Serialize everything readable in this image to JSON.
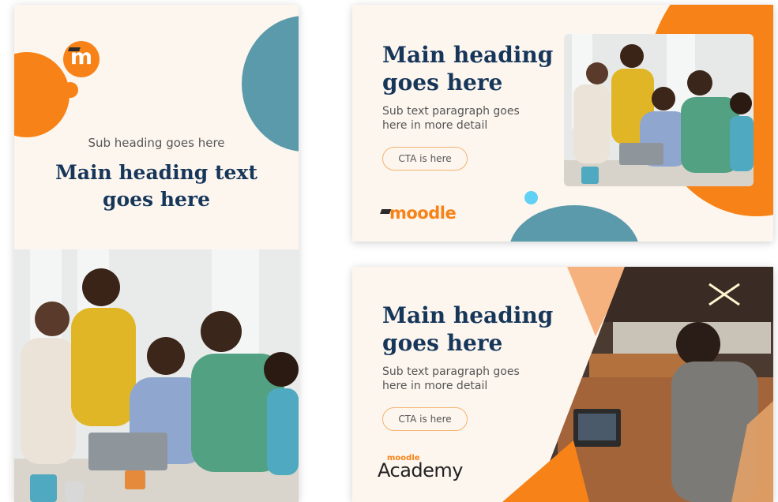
{
  "colors": {
    "orange": "#f78318",
    "teal": "#5b9aab",
    "navy": "#16365a",
    "cream": "#fdf6ef",
    "cta_border": "#f3b26f",
    "dot_blue": "#60d0f4"
  },
  "portrait_banner": {
    "logo_letter": "m",
    "logo_icon": "moodle-graduation-cap-icon",
    "sub_heading": "Sub heading goes here",
    "main_heading_line1": "Main heading text",
    "main_heading_line2": "goes here"
  },
  "landscape_banner_top": {
    "heading_line1": "Main heading",
    "heading_line2": "goes here",
    "sub_line1": "Sub text paragraph goes",
    "sub_line2": "here in more detail",
    "cta_label": "CTA is here",
    "wordmark": "moodle"
  },
  "landscape_banner_bottom": {
    "heading_line1": "Main heading",
    "heading_line2": "goes here",
    "sub_line1": "Sub text paragraph goes",
    "sub_line2": "here in more detail",
    "cta_label": "CTA is here",
    "wordmark_small": "moodle",
    "wordmark_big": "Academy"
  }
}
